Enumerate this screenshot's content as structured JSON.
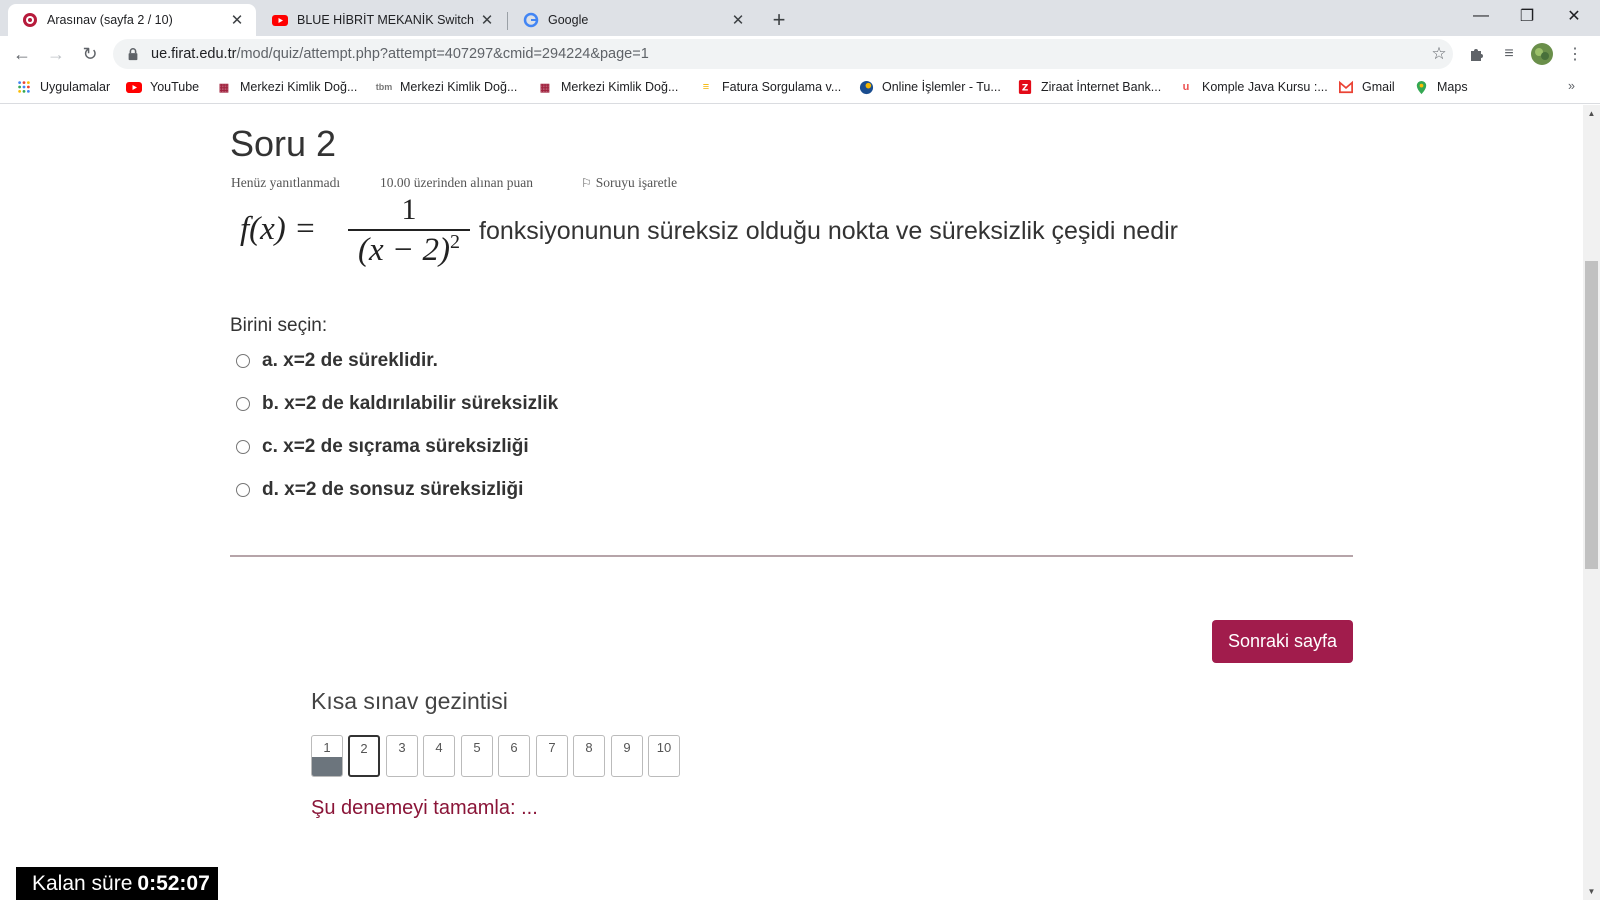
{
  "browser": {
    "tabs": [
      {
        "title": "Arasınav (sayfa 2 / 10)",
        "active": true
      },
      {
        "title": "BLUE HİBRİT MEKANİK Switch de",
        "active": false
      },
      {
        "title": "Google",
        "active": false
      }
    ],
    "url_host": "ue.firat.edu.tr",
    "url_path": "/mod/quiz/attempt.php?attempt=407297&cmid=294224&page=1",
    "bookmarks": [
      "Uygulamalar",
      "YouTube",
      "Merkezi Kimlik Doğ...",
      "Merkezi Kimlik Doğ...",
      "Merkezi Kimlik Doğ...",
      "Fatura Sorgulama v...",
      "Online İşlemler - Tu...",
      "Ziraat İnternet Bank...",
      "Komple Java Kursu :...",
      "Gmail",
      "Maps"
    ],
    "bookmarks_overflow": "»"
  },
  "question": {
    "title": "Soru 2",
    "status": "Henüz yanıtlanmadı",
    "points": "10.00 üzerinden alınan puan",
    "flag_label": "Soruyu işaretle",
    "formula": {
      "lhs": "f(x) =",
      "numerator": "1",
      "denominator": "(x − 2)",
      "exponent": "2"
    },
    "text": "fonksiyonunun süreksiz olduğu nokta ve süreksizlik çeşidi nedir",
    "prompt": "Birini seçin:",
    "options": [
      {
        "label": "a. x=2 de süreklidir.",
        "selected": false
      },
      {
        "label": "b. x=2 de kaldırılabilir süreksizlik",
        "selected": false
      },
      {
        "label": "c. x=2 de sıçrama süreksizliği",
        "selected": false
      },
      {
        "label": "d. x=2 de sonsuz süreksizliği",
        "selected": false
      }
    ]
  },
  "next_button": "Sonraki sayfa",
  "quiz_nav": {
    "title": "Kısa sınav gezintisi",
    "pages": [
      "1",
      "2",
      "3",
      "4",
      "5",
      "6",
      "7",
      "8",
      "9",
      "10"
    ],
    "answered": [
      "1"
    ],
    "current": "2",
    "finish_link": "Şu denemeyi tamamla: ..."
  },
  "timer": {
    "label": "Kalan süre",
    "value": "0:52:07"
  },
  "colors": {
    "accent": "#a11c4c",
    "link": "#8a1538",
    "answered_fill": "#6c757d"
  }
}
